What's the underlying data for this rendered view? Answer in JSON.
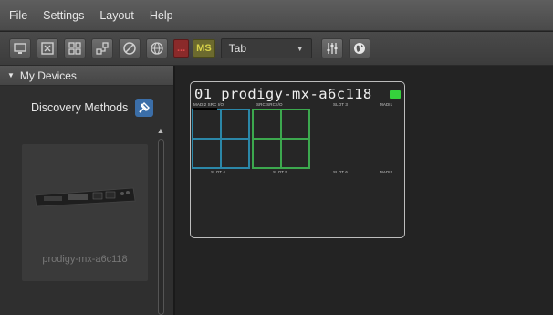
{
  "menu": [
    "File",
    "Settings",
    "Layout",
    "Help"
  ],
  "toolbar": {
    "buttons": [
      {
        "icon": "monitor-icon"
      },
      {
        "icon": "window-close-icon"
      },
      {
        "icon": "grid-icon"
      },
      {
        "icon": "network-icon"
      },
      {
        "icon": "no-entry-icon"
      },
      {
        "icon": "globe-icon"
      }
    ],
    "badge_red": "...",
    "badge_ms": "MS",
    "tab_select": {
      "value": "Tab"
    },
    "extra_buttons": [
      {
        "icon": "mixer-sliders-icon"
      },
      {
        "icon": "world-icon"
      }
    ],
    "colors": {
      "badge_red": "#d94a4a",
      "badge_ms": "#d8d24a"
    }
  },
  "sidebar": {
    "header": "My Devices",
    "discovery_label": "Discovery Methods",
    "discovery_icon": "plug-icon",
    "device_tile_label": "prodigy-mx-a6c118"
  },
  "device_card": {
    "title": "01 prodigy-mx-a6c118",
    "status_color": "#35d13c",
    "slots_top": [
      "MADI2 SRC I/O",
      "SRC SRC I/O",
      "SLOT 3",
      "MADI1"
    ],
    "slots_bottom": [
      "SLOT 4",
      "SLOT 5",
      "SLOT 6",
      "MADI2"
    ]
  }
}
